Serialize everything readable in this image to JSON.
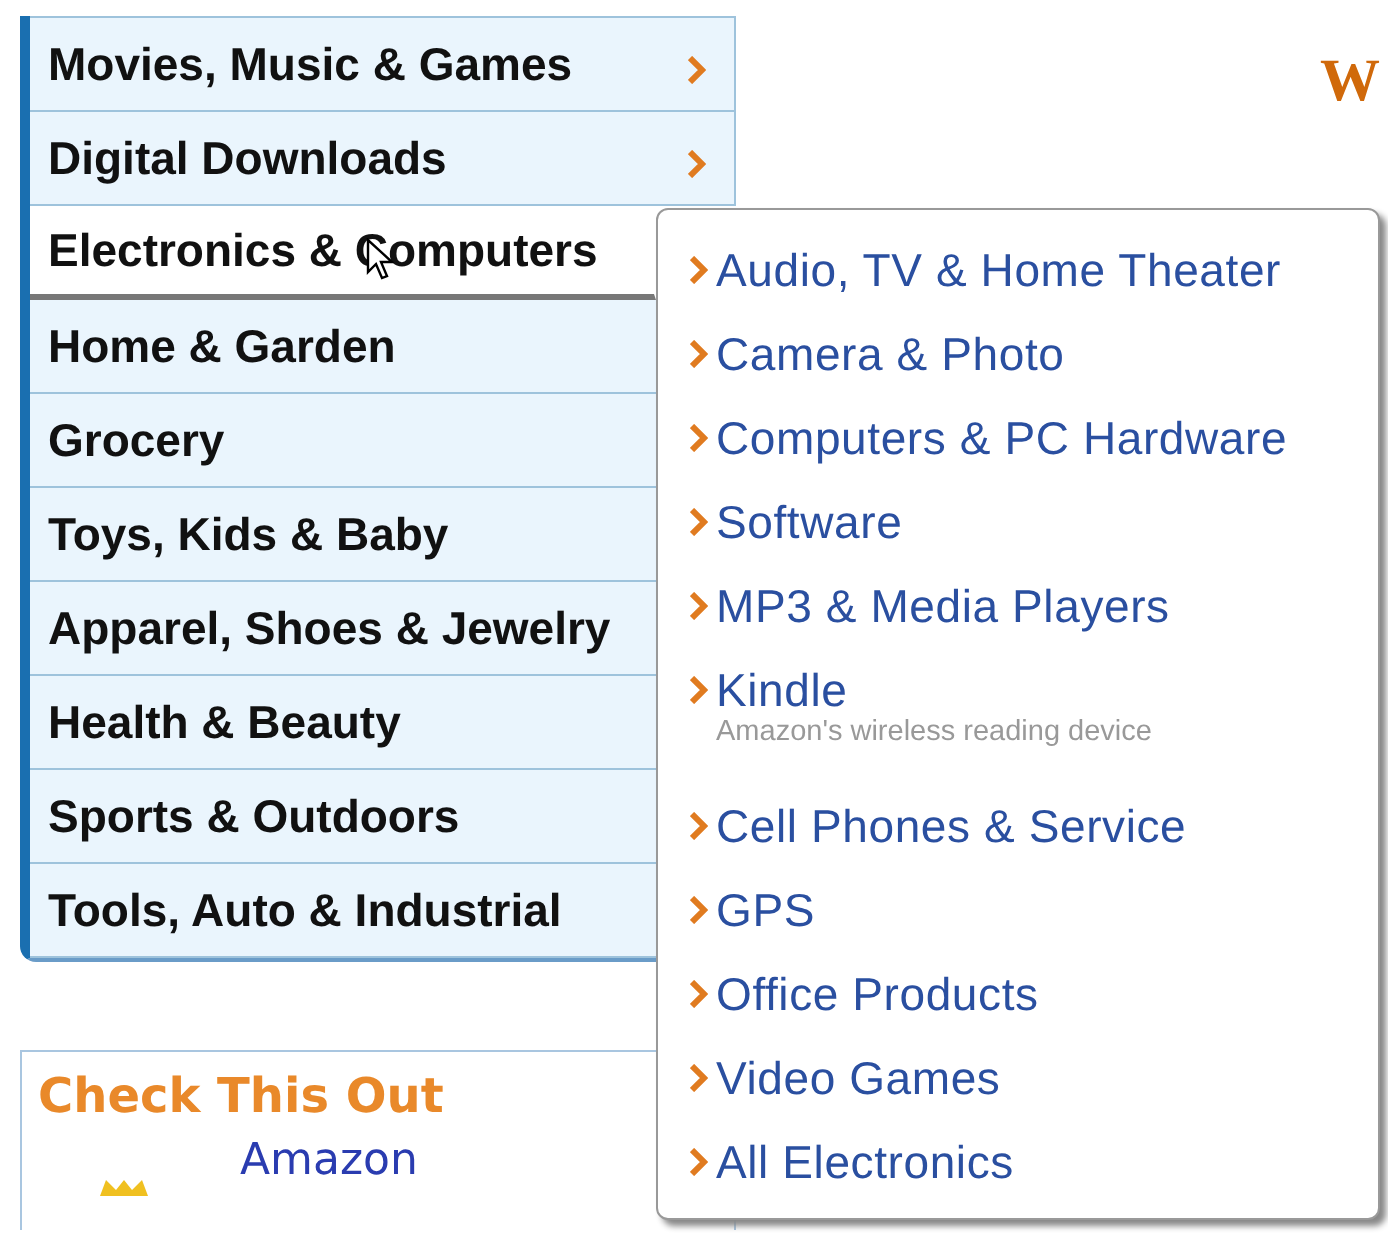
{
  "categories": [
    {
      "label": "Movies, Music & Games",
      "has_submenu": true,
      "selected": false
    },
    {
      "label": "Digital Downloads",
      "has_submenu": true,
      "selected": false
    },
    {
      "label": "Electronics & Computers",
      "selected": true
    },
    {
      "label": "Home & Garden",
      "selected": false
    },
    {
      "label": "Grocery",
      "selected": false
    },
    {
      "label": "Toys, Kids & Baby",
      "selected": false
    },
    {
      "label": "Apparel, Shoes & Jewelry",
      "selected": false
    },
    {
      "label": "Health & Beauty",
      "selected": false
    },
    {
      "label": "Sports & Outdoors",
      "selected": false
    },
    {
      "label": "Tools, Auto & Industrial",
      "selected": false
    }
  ],
  "flyout": {
    "items": [
      {
        "label": "Audio, TV & Home Theater"
      },
      {
        "label": "Camera & Photo"
      },
      {
        "label": "Computers & PC Hardware"
      },
      {
        "label": "Software"
      },
      {
        "label": "MP3 & Media Players"
      },
      {
        "label": "Kindle",
        "subtitle": "Amazon's wireless reading device"
      },
      {
        "label": "Cell Phones & Service"
      },
      {
        "label": "GPS"
      },
      {
        "label": "Office Products"
      },
      {
        "label": "Video Games"
      },
      {
        "label": "All Electronics"
      }
    ]
  },
  "check_this_out": {
    "title": "Check This Out",
    "link": "Amazon"
  },
  "right_heading": "W"
}
